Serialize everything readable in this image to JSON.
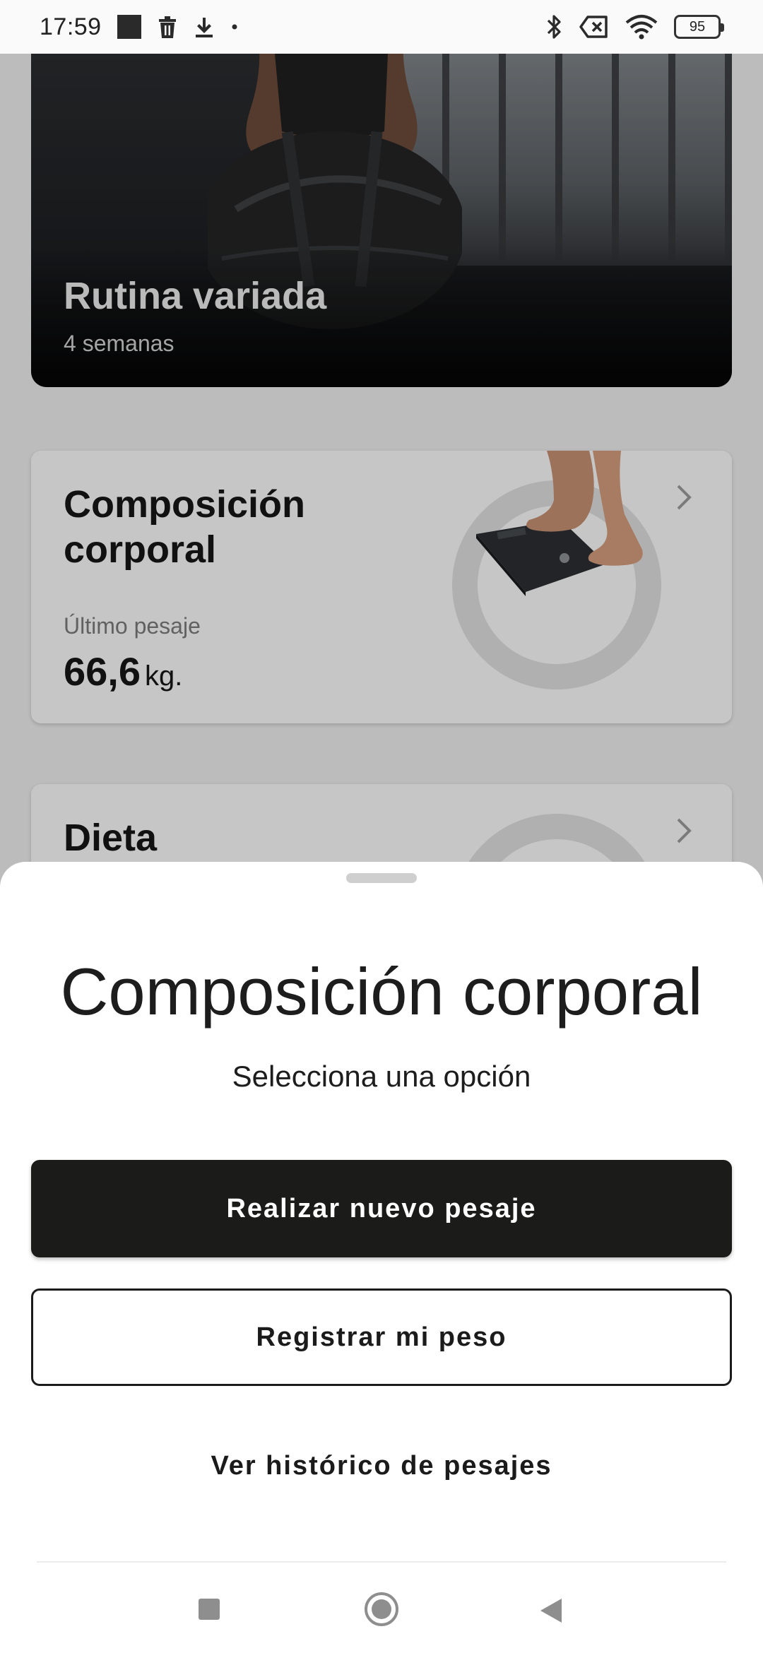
{
  "status_bar": {
    "time": "17:59",
    "battery": "95",
    "left_icons": [
      "square-icon",
      "trash-icon",
      "download-icon",
      "dot-icon"
    ],
    "right_icons": [
      "bluetooth-icon",
      "sim-off-icon",
      "wifi-icon",
      "battery-icon"
    ]
  },
  "routine_card": {
    "title": "Rutina variada",
    "subtitle": "4 semanas"
  },
  "body_composition_card": {
    "title": "Composición corporal",
    "last_weigh_label": "Último pesaje",
    "last_weigh_value": "66,6",
    "last_weigh_unit": "kg."
  },
  "diet_card": {
    "title": "Dieta"
  },
  "sheet": {
    "title": "Composición corporal",
    "subtitle": "Selecciona una opción",
    "primary_button": "Realizar nuevo pesaje",
    "secondary_button": "Registrar mi peso",
    "text_button": "Ver histórico de pesajes"
  },
  "nav_bar": {
    "icons": [
      "recents-icon",
      "home-icon",
      "back-icon"
    ]
  },
  "colors": {
    "primary_button": "#1b1b19",
    "sheet_background": "#ffffff",
    "scrim": "rgba(0,0,0,0.20)"
  }
}
